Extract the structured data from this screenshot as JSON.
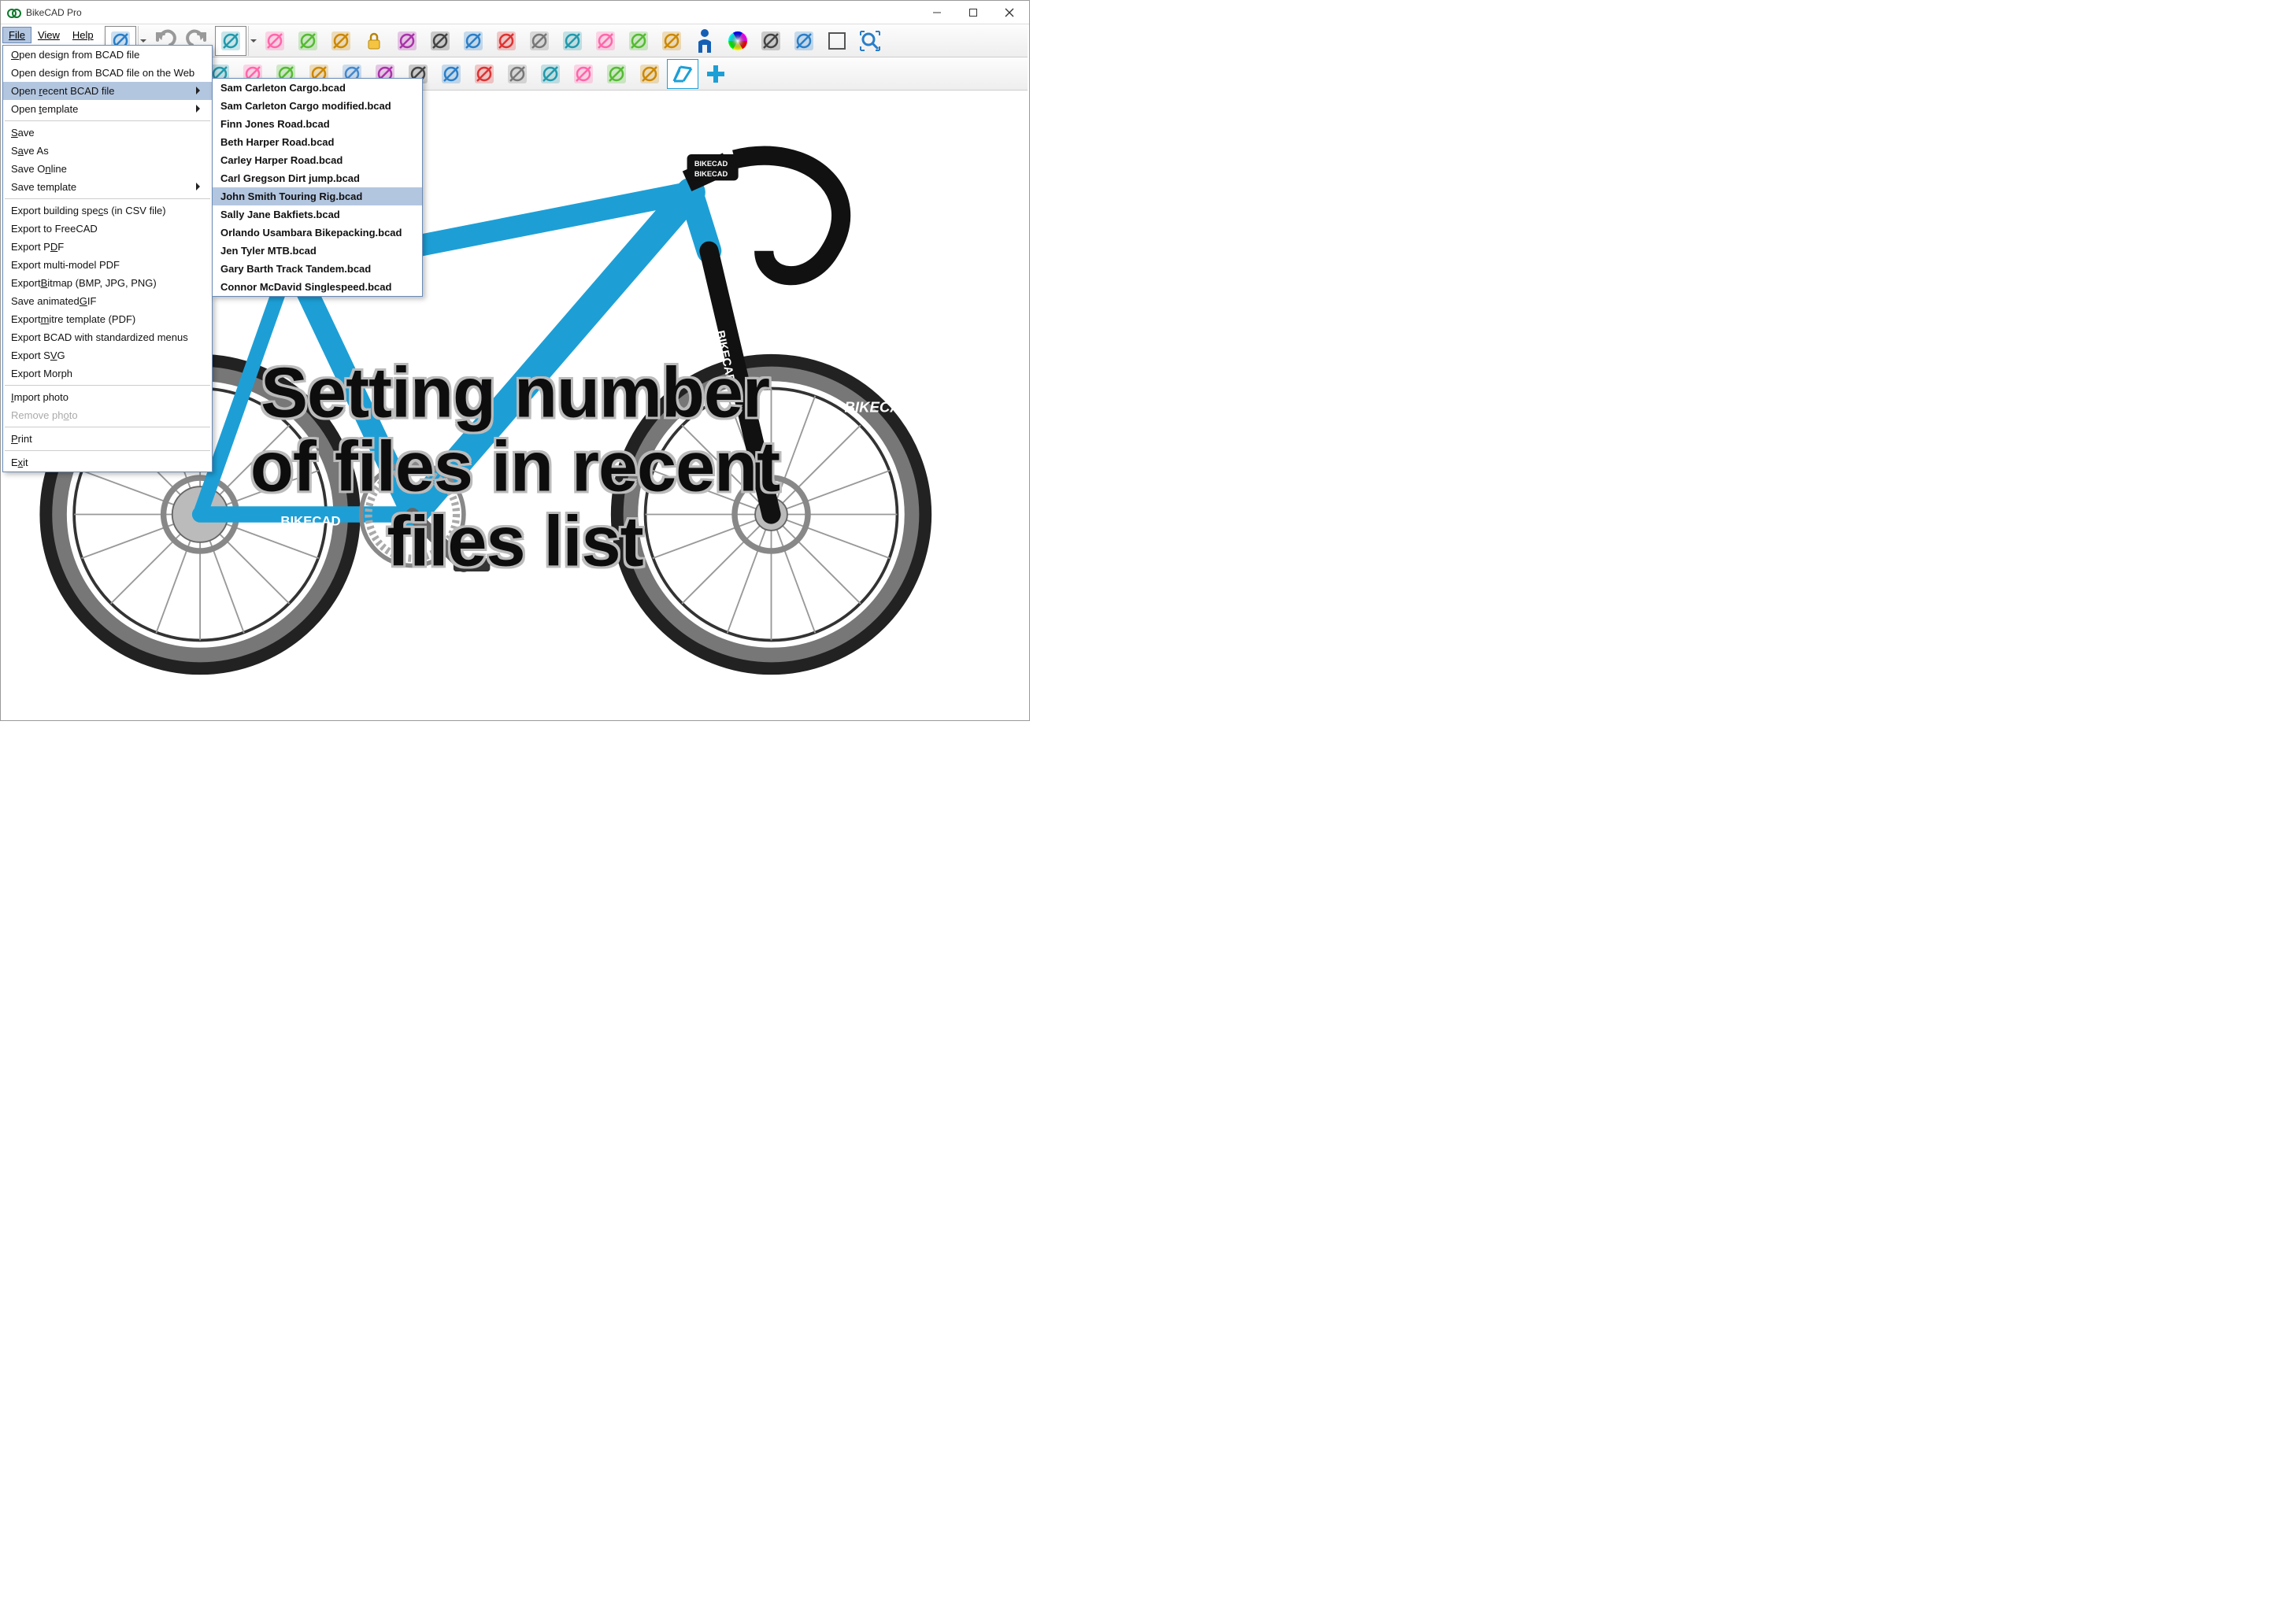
{
  "titlebar": {
    "title": "BikeCAD Pro"
  },
  "menubar": {
    "file": "File",
    "view": "View",
    "help": "Help"
  },
  "file_menu": {
    "open_bcad": "Open design from BCAD file",
    "open_web": "Open design from BCAD file on the Web",
    "open_recent": "Open recent BCAD file",
    "open_template": "Open template",
    "save": "Save",
    "save_as": "Save As",
    "save_online": "Save Online",
    "save_template": "Save template",
    "export_csv": "Export building specs (in CSV file)",
    "export_freecad": "Export to FreeCAD",
    "export_pdf": "Export PDF",
    "export_multi_pdf": "Export multi-model PDF",
    "export_bitmap": "Export Bitmap (BMP, JPG, PNG)",
    "save_gif": "Save animated GIF",
    "export_mitre": "Export mitre template (PDF)",
    "export_std": "Export BCAD with standardized menus",
    "export_svg": "Export SVG",
    "export_morph": "Export Morph",
    "import_photo": "Import photo",
    "remove_photo": "Remove photo",
    "print": "Print",
    "exit": "Exit"
  },
  "recent_files": [
    "Sam Carleton Cargo.bcad",
    "Sam Carleton Cargo modified.bcad",
    "Finn Jones Road.bcad",
    "Beth Harper Road.bcad",
    "Carley Harper Road.bcad",
    "Carl Gregson Dirt jump.bcad",
    "John Smith Touring Rig.bcad",
    "Sally Jane Bakfiets.bcad",
    "Orlando Usambara Bikepacking.bcad",
    "Jen Tyler MTB.bcad",
    "Gary Barth Track Tandem.bcad",
    "Connor McDavid Singlespeed.bcad"
  ],
  "recent_files_highlight_index": 6,
  "toolbar1_icons": [
    "dimensions-icon",
    "undo-icon",
    "redo-icon",
    "paint-icon",
    "paint-drop-icon",
    "magnet-icon",
    "fork-icon",
    "lock-icon",
    "texture-icon",
    "red-swoosh-icon",
    "compass-icon",
    "book-icon",
    "title-block-icon",
    "rainbow-icon",
    "eye-icon",
    "hdim-icon",
    "note-icon",
    "person-icon",
    "color-wheel-icon",
    "chainring-icon",
    "extrude-icon",
    "square-icon",
    "zoom-fit-icon"
  ],
  "toolbar2_icons": [
    "handlebar-icon",
    "stem-icon",
    "seatpost-icon",
    "saddle-icon",
    "headset-icon",
    "fork2-icon",
    "frame-icon",
    "bottle-icon",
    "hub-icon",
    "crank-icon",
    "dropout-icon",
    "cassette-icon",
    "brake-lever-icon",
    "caliper-icon",
    "pedal-icon",
    "deraileur-icon",
    "chainring2-icon",
    "frame-select-icon",
    "add-icon"
  ],
  "decals": {
    "toptube": "BIKECAD",
    "chainstay": "BIKECAD",
    "fork": "BIKECAD",
    "stem1": "BIKECAD",
    "stem2": "BIKECAD",
    "rim": "BIKECA"
  },
  "overlay": {
    "l1": "Setting number",
    "l2": "of files in recent",
    "l3": "files list"
  },
  "colors": {
    "frame": "#1d9fd6",
    "highlight": "#b3c6e0"
  }
}
